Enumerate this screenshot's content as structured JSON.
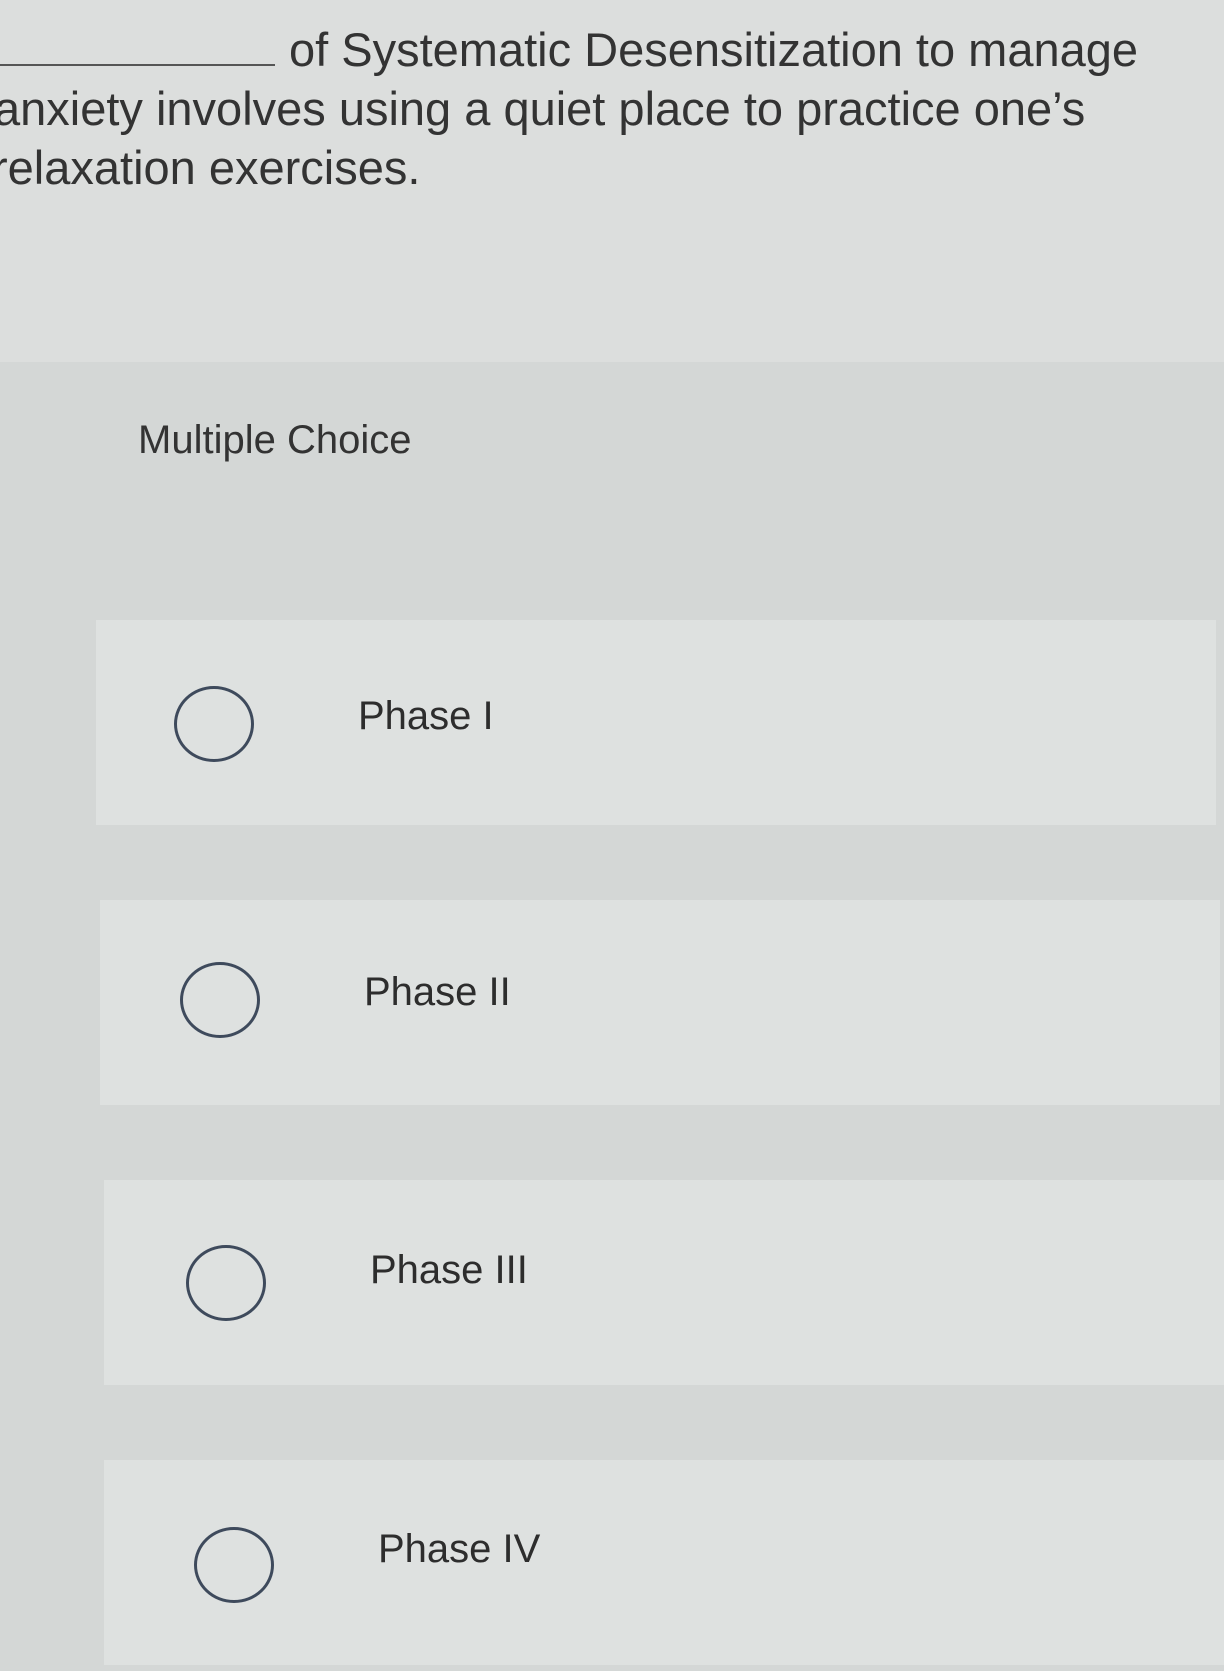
{
  "question": {
    "line1": "of Systematic Desensitization to manage",
    "line2": "anxiety involves using a quiet place to practice one’s",
    "line3": "relaxation exercises."
  },
  "question_type": "Multiple Choice",
  "options": [
    {
      "label": "Phase I",
      "selected": false
    },
    {
      "label": "Phase II",
      "selected": false
    },
    {
      "label": "Phase III",
      "selected": false
    },
    {
      "label": "Phase IV",
      "selected": false
    }
  ]
}
